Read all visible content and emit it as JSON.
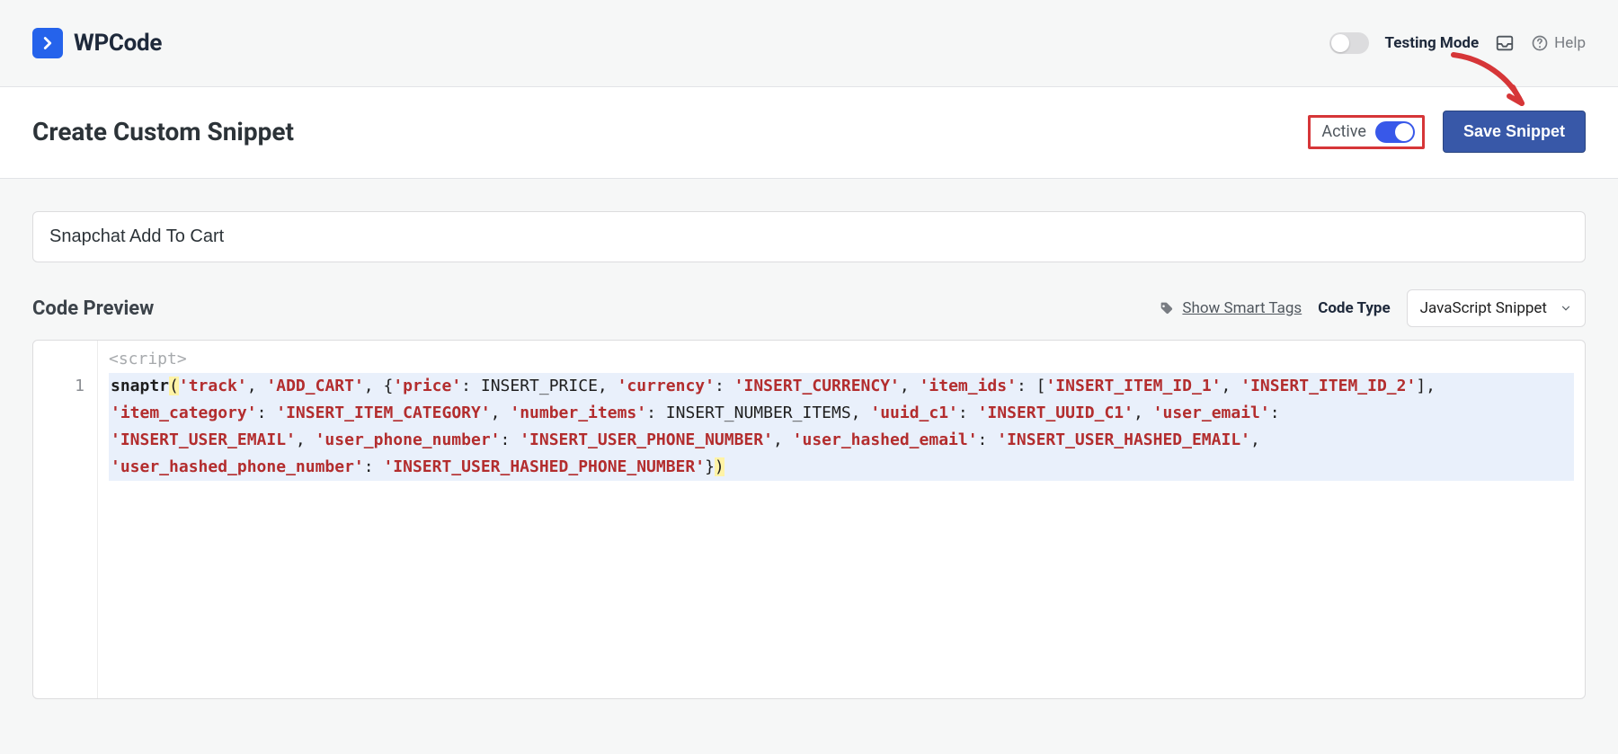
{
  "brand": {
    "name": "WPCode"
  },
  "topbar": {
    "testing_mode_label": "Testing Mode",
    "help_label": "Help"
  },
  "header": {
    "title": "Create Custom Snippet",
    "active_label": "Active",
    "save_label": "Save Snippet"
  },
  "snippet": {
    "title_value": "Snapchat Add To Cart"
  },
  "code_preview": {
    "title": "Code Preview",
    "smart_tags_label": "Show Smart Tags",
    "code_type_label": "Code Type",
    "code_type_value": "JavaScript Snippet"
  },
  "editor": {
    "line_number_1": "1",
    "script_open": "<script>",
    "line1": {
      "fn": "snaptr",
      "p_open": "(",
      "s1": "'track'",
      "c1": ", ",
      "s2": "'ADD_CART'",
      "c2": ", {",
      "k1": "'price'",
      "col1": ": ",
      "v1": "INSERT_PRICE",
      "c3": ", ",
      "k2": "'currency'",
      "col2": ": ",
      "v2": "'INSERT_CURRENCY'",
      "c4": ", ",
      "k3": "'item_ids'",
      "col3": ": [",
      "v3a": "'INSERT_ITEM_ID_1'",
      "c5": ", ",
      "v3b": "'INSERT_ITEM_ID_2'",
      "c6": "],"
    },
    "line2": {
      "k1": "'item_category'",
      "col1": ": ",
      "v1": "'INSERT_ITEM_CATEGORY'",
      "c1": ", ",
      "k2": "'number_items'",
      "col2": ": ",
      "v2": "INSERT_NUMBER_ITEMS",
      "c2": ", ",
      "k3": "'uuid_c1'",
      "col3": ": ",
      "v3": "'INSERT_UUID_C1'",
      "c3": ", ",
      "k4": "'user_email'",
      "col4": ":"
    },
    "line3": {
      "v1": "'INSERT_USER_EMAIL'",
      "c1": ", ",
      "k1": "'user_phone_number'",
      "col1": ": ",
      "v2": "'INSERT_USER_PHONE_NUMBER'",
      "c2": ", ",
      "k2": "'user_hashed_email'",
      "col2": ": ",
      "v3": "'INSERT_USER_HASHED_EMAIL'",
      "c3": ","
    },
    "line4": {
      "k1": "'user_hashed_phone_number'",
      "col1": ": ",
      "v1": "'INSERT_USER_HASHED_PHONE_NUMBER'",
      "close": "})"
    }
  }
}
